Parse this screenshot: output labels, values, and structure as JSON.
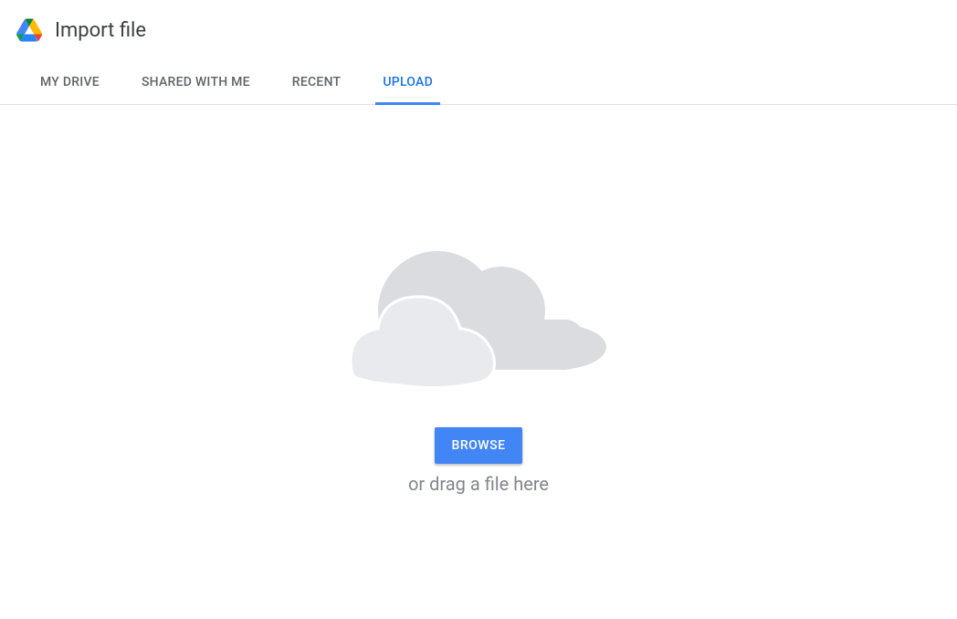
{
  "header": {
    "title": "Import file"
  },
  "tabs": {
    "items": [
      {
        "label": "MY DRIVE"
      },
      {
        "label": "SHARED WITH ME"
      },
      {
        "label": "RECENT"
      },
      {
        "label": "UPLOAD"
      }
    ],
    "active_index": 3
  },
  "upload": {
    "browse_label": "BROWSE",
    "drag_text": "or drag a file here"
  }
}
